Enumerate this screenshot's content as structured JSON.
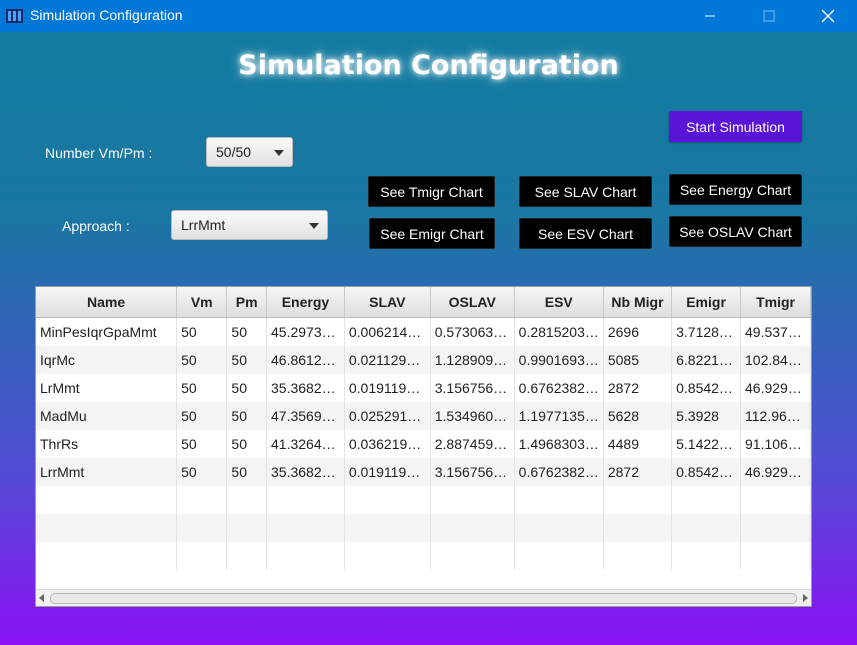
{
  "window": {
    "title": "Simulation Configuration"
  },
  "page": {
    "heading": "Simulation Configuration"
  },
  "form": {
    "vmpm_label": "Number Vm/Pm :",
    "vmpm_value": "50/50",
    "approach_label": "Approach :",
    "approach_value": "LrrMmt"
  },
  "buttons": {
    "start": "Start Simulation",
    "tmigr": "See Tmigr Chart",
    "emigr": "See Emigr Chart",
    "slav": "See SLAV Chart",
    "esv": "See ESV Chart",
    "energy": "See Energy Chart",
    "oslav": "See OSLAV Chart"
  },
  "table": {
    "columns": [
      "Name",
      "Vm",
      "Pm",
      "Energy",
      "SLAV",
      "OSLAV",
      "ESV",
      "Nb Migr",
      "Emigr",
      "Tmigr"
    ],
    "rows": [
      [
        "MinPesIqrGpaMmt",
        "50",
        "50",
        "45.2973…",
        "0.006214…",
        "0.573063…",
        "0.2815203…",
        "2696",
        "3.7128…",
        "49.537…"
      ],
      [
        "IqrMc",
        "50",
        "50",
        "46.8612…",
        "0.021129…",
        "1.128909…",
        "0.9901693…",
        "5085",
        "6.8221…",
        "102.84…"
      ],
      [
        "LrMmt",
        "50",
        "50",
        "35.3682…",
        "0.019119…",
        "3.156756…",
        "0.6762382…",
        "2872",
        "0.8542…",
        "46.929…"
      ],
      [
        "MadMu",
        "50",
        "50",
        "47.3569…",
        "0.025291…",
        "1.534960…",
        "1.1977135…",
        "5628",
        "5.3928",
        "112.96…"
      ],
      [
        "ThrRs",
        "50",
        "50",
        "41.3264…",
        "0.036219…",
        "2.887459…",
        "1.4968303…",
        "4489",
        "5.1422…",
        "91.106…"
      ],
      [
        "LrrMmt",
        "50",
        "50",
        "35.3682…",
        "0.019119…",
        "3.156756…",
        "0.6762382…",
        "2872",
        "0.8542…",
        "46.929…"
      ]
    ]
  },
  "colors": {
    "titlebar": "#0078d7",
    "gradient_top": "#127ca0",
    "gradient_bottom": "#8a12f4",
    "start_button": "#5a14d8"
  },
  "icons": {
    "app": "window-app-icon",
    "minimize": "minimize-icon",
    "maximize": "maximize-icon",
    "close": "close-icon"
  }
}
